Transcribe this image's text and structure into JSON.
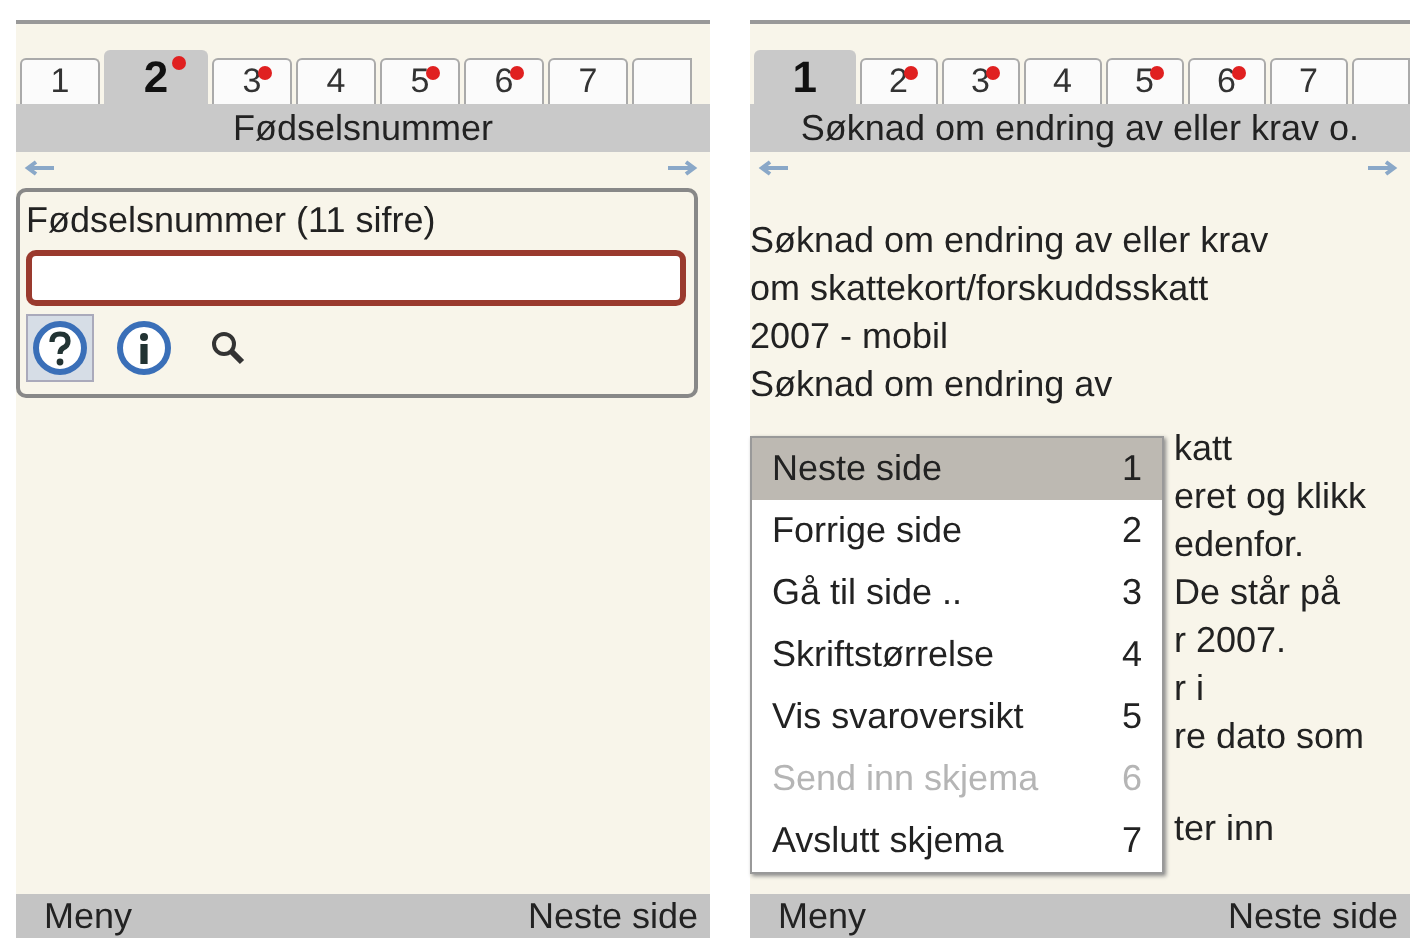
{
  "screens": [
    {
      "tabs": [
        {
          "label": "1",
          "selected": false,
          "marked": false
        },
        {
          "label": "2",
          "selected": true,
          "marked": true
        },
        {
          "label": "3",
          "selected": false,
          "marked": true
        },
        {
          "label": "4",
          "selected": false,
          "marked": false
        },
        {
          "label": "5",
          "selected": false,
          "marked": true
        },
        {
          "label": "6",
          "selected": false,
          "marked": true
        },
        {
          "label": "7",
          "selected": false,
          "marked": false
        }
      ],
      "title": "Fødselsnummer",
      "field_group": {
        "label": "Fødselsnummer (11 sifre)",
        "tools": [
          {
            "kind": "help",
            "selected": true
          },
          {
            "kind": "info",
            "selected": false
          },
          {
            "kind": "search",
            "selected": false
          }
        ]
      },
      "softkeys": {
        "left": "Meny",
        "right": "Neste side"
      }
    },
    {
      "tabs": [
        {
          "label": "1",
          "selected": true,
          "marked": false
        },
        {
          "label": "2",
          "selected": false,
          "marked": true
        },
        {
          "label": "3",
          "selected": false,
          "marked": true
        },
        {
          "label": "4",
          "selected": false,
          "marked": false
        },
        {
          "label": "5",
          "selected": false,
          "marked": true
        },
        {
          "label": "6",
          "selected": false,
          "marked": true
        },
        {
          "label": "7",
          "selected": false,
          "marked": false
        }
      ],
      "title": "Søknad om endring av eller krav o.",
      "lines": [
        "Søknad om endring av eller krav",
        "om skattekort/forskuddsskatt",
        "2007 - mobil",
        "Søknad om endring av"
      ],
      "lines_behind_menu": [
        "katt",
        "eret og klikk",
        "edenfor.",
        "De står på",
        "r 2007.",
        "r i",
        "re dato som",
        "ter inn"
      ],
      "menu": [
        {
          "label": "Neste side",
          "key": "1",
          "selected": true,
          "disabled": false
        },
        {
          "label": "Forrige side",
          "key": "2",
          "selected": false,
          "disabled": false
        },
        {
          "label": "Gå til side ..",
          "key": "3",
          "selected": false,
          "disabled": false
        },
        {
          "label": "Skriftstørrelse",
          "key": "4",
          "selected": false,
          "disabled": false
        },
        {
          "label": "Vis svaroversikt",
          "key": "5",
          "selected": false,
          "disabled": false
        },
        {
          "label": "Send inn skjema",
          "key": "6",
          "selected": false,
          "disabled": true
        },
        {
          "label": "Avslutt skjema",
          "key": "7",
          "selected": false,
          "disabled": false
        }
      ],
      "softkeys": {
        "left": "Meny",
        "right": "Neste side"
      }
    }
  ]
}
